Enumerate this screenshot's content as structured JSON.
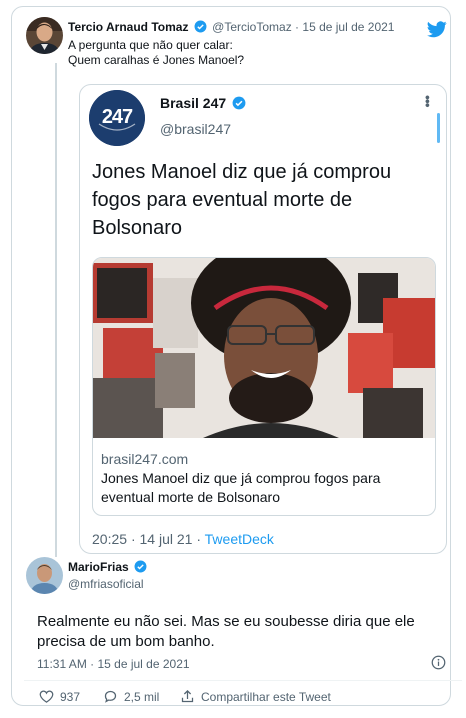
{
  "colors": {
    "accent": "#1d9bf0",
    "text": "#0f1419",
    "muted": "#536471",
    "border": "#cfd9de"
  },
  "tweet": {
    "name": "Tercio Arnaud Tomaz",
    "handle": "@TercioTomaz",
    "sep": "·",
    "date": "15 de jul de 2021",
    "line1": "A pergunta que não quer calar:",
    "line2": "Quem caralhas é Jones Manoel?"
  },
  "embed": {
    "avatar_text": "247",
    "name": "Brasil 247",
    "handle": "@brasil247",
    "title": "Jones Manoel diz que já comprou fogos para eventual morte de Bolsonaro",
    "link_domain": "brasil247.com",
    "link_title": "Jones Manoel diz que já comprou fogos para eventual morte de Bolsonaro",
    "time": "20:25",
    "sep": "·",
    "date": "14 jul 21",
    "source": "TweetDeck"
  },
  "reply": {
    "name": "MarioFrias",
    "handle": "@mfriasoficial",
    "text": "Realmente eu não sei. Mas se eu soubesse diria que ele precisa de um bom banho.",
    "timestamp": "11:31 AM · 15 de jul de 2021"
  },
  "actions": {
    "likes": "937",
    "replies": "2,5 mil",
    "share": "Compartilhar este Tweet"
  }
}
